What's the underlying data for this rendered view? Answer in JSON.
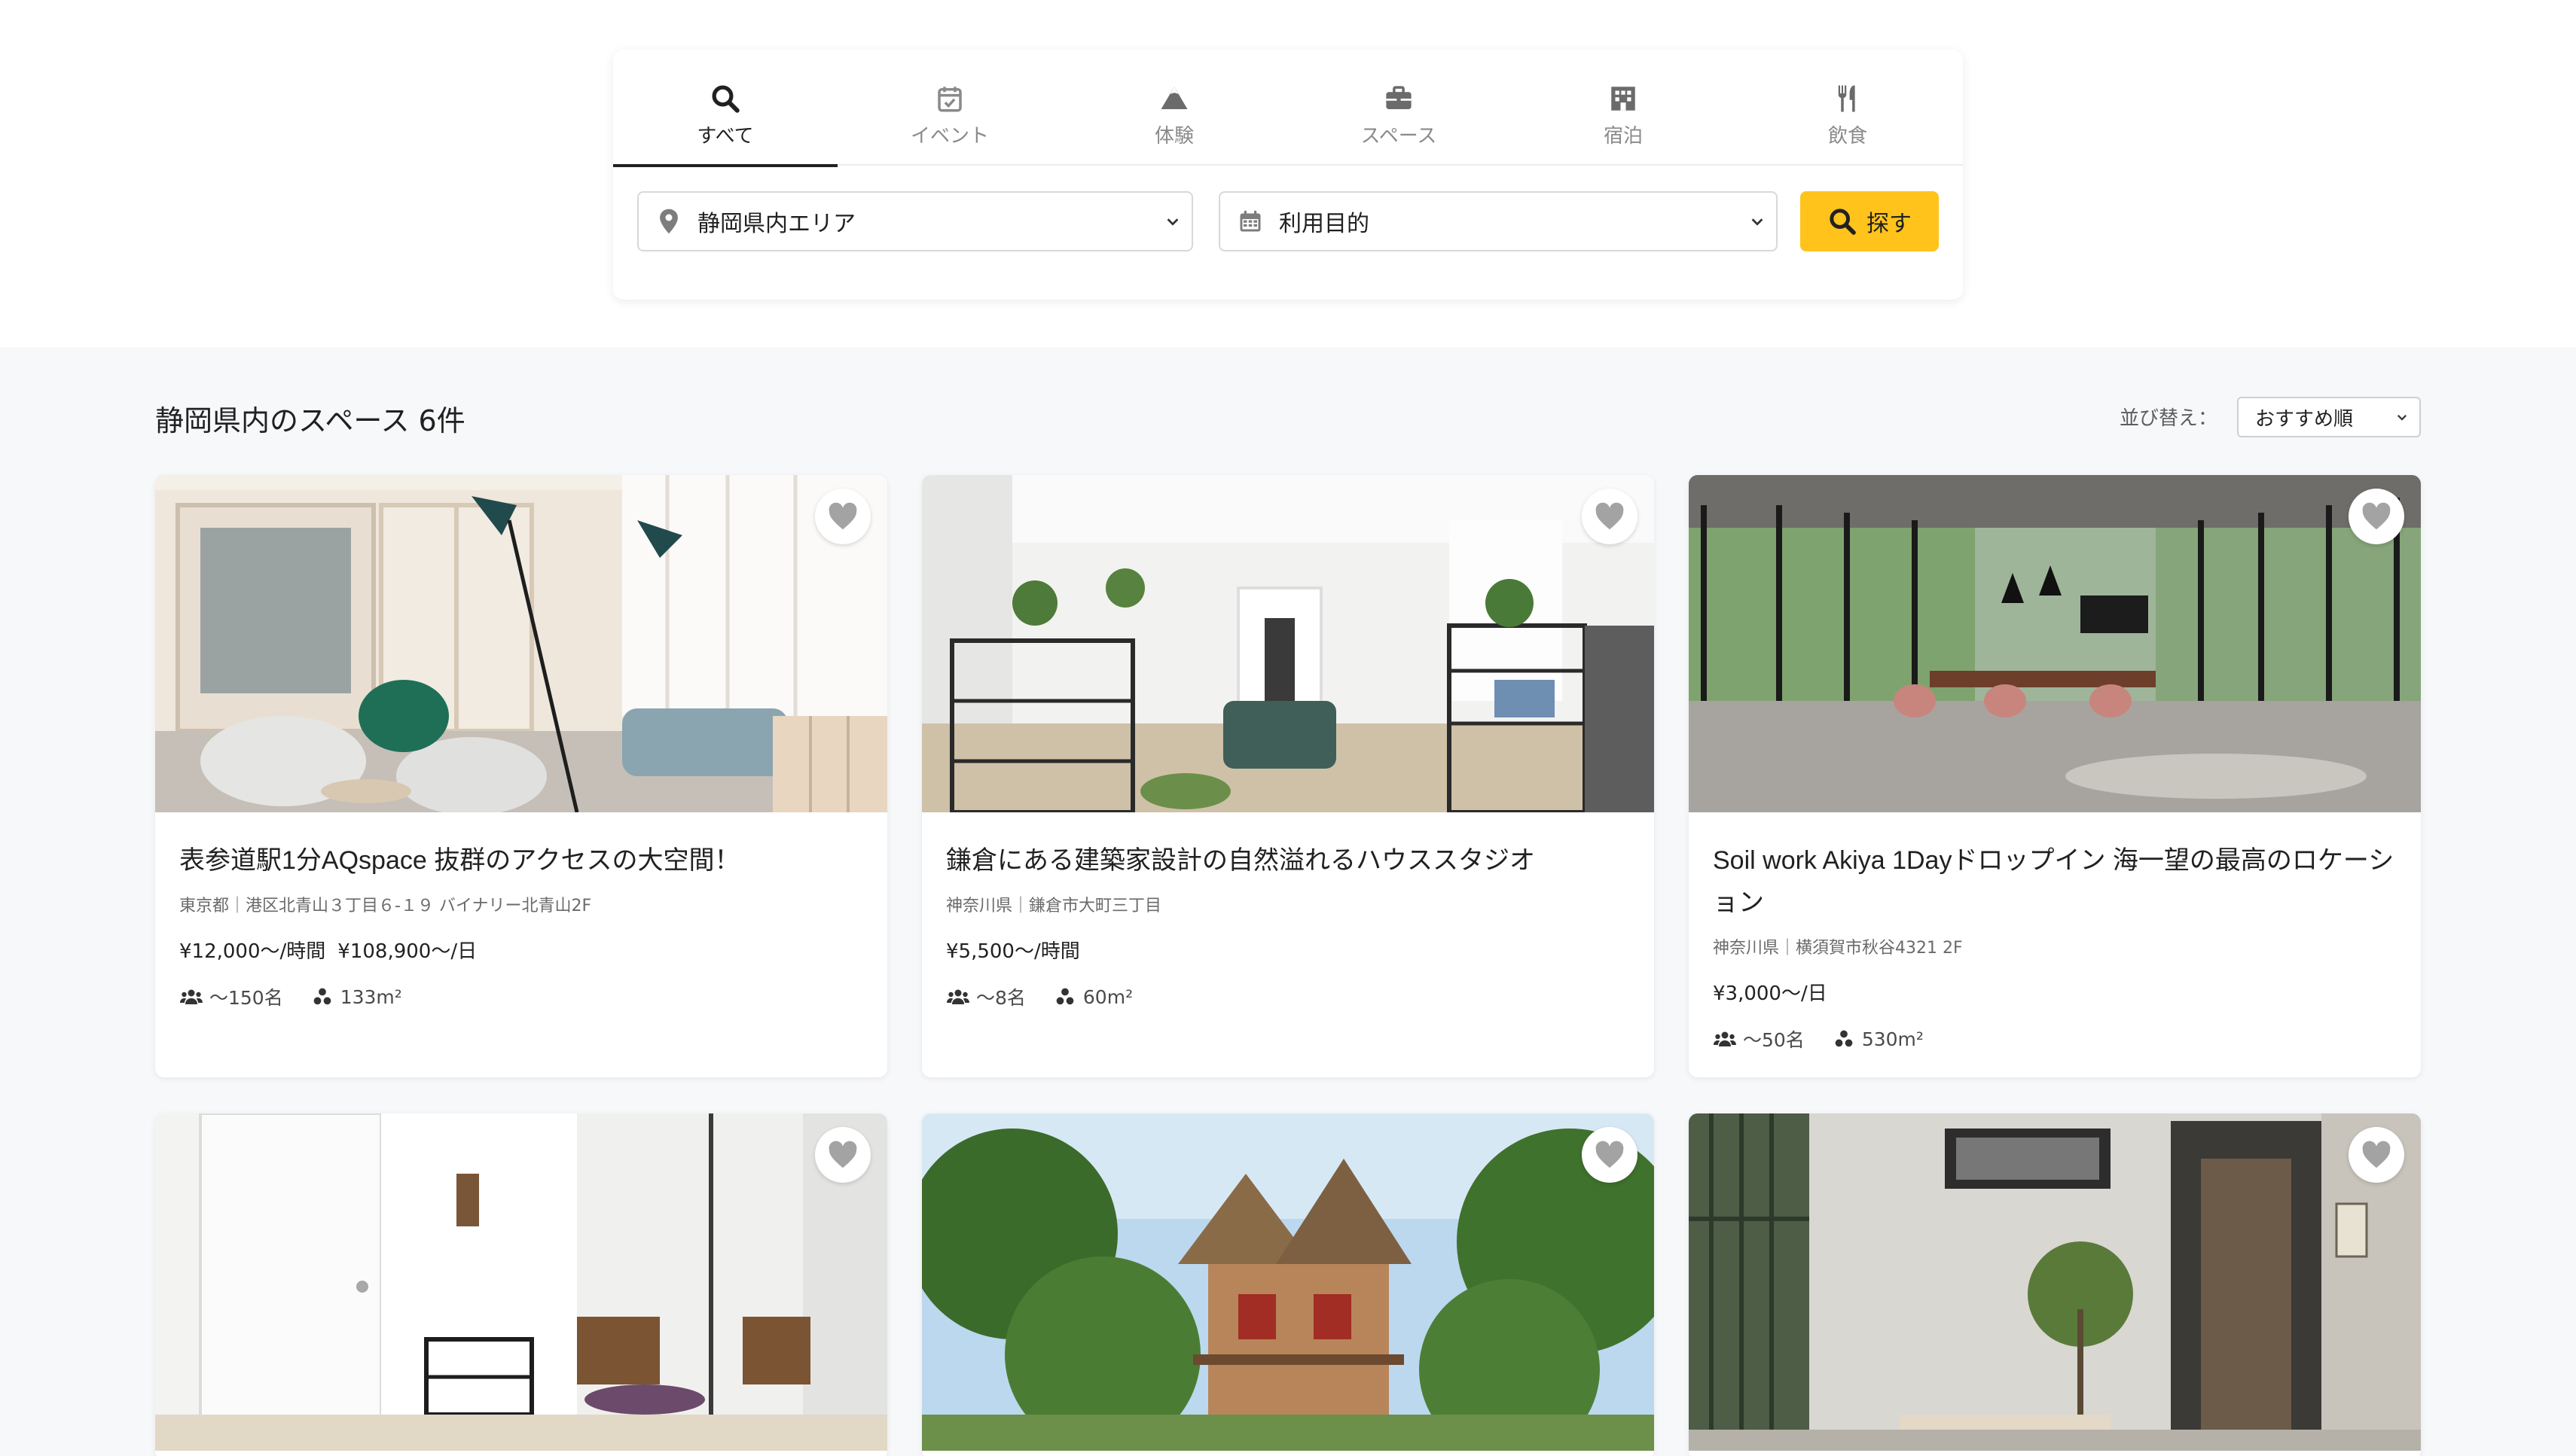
{
  "tabs": [
    {
      "label": "すべて",
      "icon": "search-icon",
      "active": true
    },
    {
      "label": "イベント",
      "icon": "calendar-check-icon",
      "active": false
    },
    {
      "label": "体験",
      "icon": "mountain-icon",
      "active": false
    },
    {
      "label": "スペース",
      "icon": "briefcase-icon",
      "active": false
    },
    {
      "label": "宿泊",
      "icon": "hotel-building-icon",
      "active": false
    },
    {
      "label": "飲食",
      "icon": "utensils-icon",
      "active": false
    }
  ],
  "search": {
    "area_value": "静岡県内エリア",
    "purpose_value": "利用目的",
    "button_label": "探す",
    "accent_color": "#ffc31c"
  },
  "results": {
    "title": "静岡県内のスペース 6件",
    "sort_label": "並び替え：",
    "sort_value": "おすすめ順"
  },
  "cards": [
    {
      "title": "表参道駅1分AQspace 抜群のアクセスの大空間！",
      "address": "東京都｜港区北青山３丁目６-１９ バイナリー北青山2F",
      "prices": [
        "¥12,000〜/時間",
        "¥108,900〜/日"
      ],
      "capacity": "〜150名",
      "area": "133m²"
    },
    {
      "title": "鎌倉にある建築家設計の自然溢れるハウススタジオ",
      "address": "神奈川県｜鎌倉市大町三丁目",
      "prices": [
        "¥5,500〜/時間"
      ],
      "capacity": "〜8名",
      "area": "60m²"
    },
    {
      "title": "Soil work Akiya 1Dayドロップイン 海一望の最高のロケーション",
      "address": "神奈川県｜横須賀市秋谷4321 2F",
      "prices": [
        "¥3,000〜/日"
      ],
      "capacity": "〜50名",
      "area": "530m²"
    }
  ]
}
